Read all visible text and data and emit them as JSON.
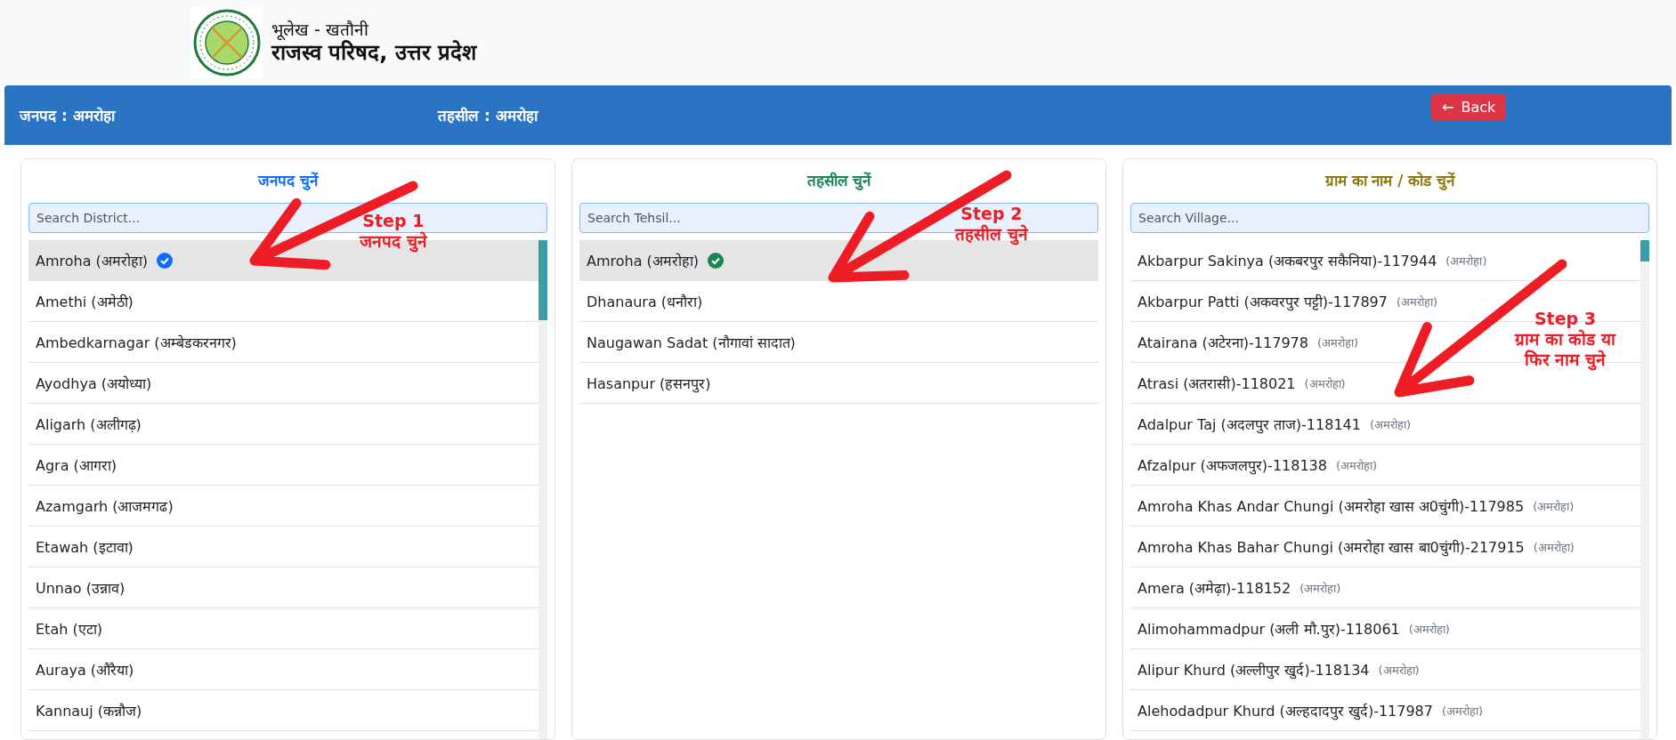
{
  "header": {
    "subtitle": "भूलेख - खतौनी",
    "title": "राजस्व परिषद, उत्तर प्रदेश"
  },
  "location_bar": {
    "district": "जनपद : अमरोहा",
    "tehsil": "तहसील : अमरोहा",
    "back_button": {
      "icon": "←",
      "label": "Back"
    }
  },
  "panels": [
    {
      "kind": "district",
      "title": "जनपद चुनें",
      "search": {
        "placeholder": "Search District..."
      },
      "scrollbar": true,
      "annotation": {
        "lines": [
          "Step 1",
          "जनपद चुने"
        ]
      },
      "items": [
        {
          "label": "Amroha (अमरोहा)",
          "selected": true
        },
        {
          "label": "Amethi (अमेठी)",
          "selected": false
        },
        {
          "label": "Ambedkarnagar (अम्बेडकरनगर)",
          "selected": false
        },
        {
          "label": "Ayodhya (अयोध्या)",
          "selected": false
        },
        {
          "label": "Aligarh (अलीगढ़)",
          "selected": false
        },
        {
          "label": "Agra (आगरा)",
          "selected": false
        },
        {
          "label": "Azamgarh (आजमगढ)",
          "selected": false
        },
        {
          "label": "Etawah (इटावा)",
          "selected": false
        },
        {
          "label": "Unnao (उन्नाव)",
          "selected": false
        },
        {
          "label": "Etah (एटा)",
          "selected": false
        },
        {
          "label": "Auraya (औरैया)",
          "selected": false
        },
        {
          "label": "Kannauj (कन्नौज)",
          "selected": false
        }
      ]
    },
    {
      "kind": "tehsil",
      "title": "तहसील चुनें",
      "search": {
        "placeholder": "Search Tehsil..."
      },
      "scrollbar": false,
      "annotation": {
        "lines": [
          "Step 2",
          "तहसील चुने"
        ]
      },
      "items": [
        {
          "label": "Amroha (अमरोहा)",
          "selected": true
        },
        {
          "label": "Dhanaura (धनौरा)",
          "selected": false
        },
        {
          "label": "Naugawan Sadat (नौगावां सादात)",
          "selected": false
        },
        {
          "label": "Hasanpur (हसनपुर)",
          "selected": false
        }
      ]
    },
    {
      "kind": "village",
      "title": "ग्राम का नाम / कोड चुनें",
      "search": {
        "placeholder": "Search Village..."
      },
      "scrollbar": true,
      "annotation": {
        "lines": [
          "Step 3",
          "ग्राम का कोड या",
          "फिर नाम चुने"
        ]
      },
      "items": [
        {
          "label": "Akbarpur Sakinya (अकबरपुर सकैनिया)-117944",
          "note": "(अमरोहा)",
          "selected": false
        },
        {
          "label": "Akbarpur Patti (अकवरपुर पट्टी)-117897",
          "note": "(अमरोहा)",
          "selected": false
        },
        {
          "label": "Atairana (अटेरना)-117978",
          "note": "(अमरोहा)",
          "selected": false
        },
        {
          "label": "Atrasi (अतरासी)-118021",
          "note": "(अमरोहा)",
          "selected": false
        },
        {
          "label": "Adalpur Taj (अदलपुर ताज)-118141",
          "note": "(अमरोहा)",
          "selected": false
        },
        {
          "label": "Afzalpur (अफजलपुर)-118138",
          "note": "(अमरोहा)",
          "selected": false
        },
        {
          "label": "Amroha Khas Andar Chungi (अमरोहा खास अ0चुंगी)-117985",
          "note": "(अमरोहा)",
          "selected": false
        },
        {
          "label": "Amroha Khas Bahar Chungi (अमरोहा खास बा0चुंगी)-217915",
          "note": "(अमरोहा)",
          "selected": false
        },
        {
          "label": "Amera (अमेढ़ा)-118152",
          "note": "(अमरोहा)",
          "selected": false
        },
        {
          "label": "Alimohammadpur (अली मौ.पुर)-118061",
          "note": "(अमरोहा)",
          "selected": false
        },
        {
          "label": "Alipur Khurd (अल्लीपुर खुर्द)-118134",
          "note": "(अमरोहा)",
          "selected": false
        },
        {
          "label": "Alehodadpur Khurd (अल्हदादपुर खुर्द)-117987",
          "note": "(अमरोहा)",
          "selected": false
        }
      ]
    }
  ]
}
